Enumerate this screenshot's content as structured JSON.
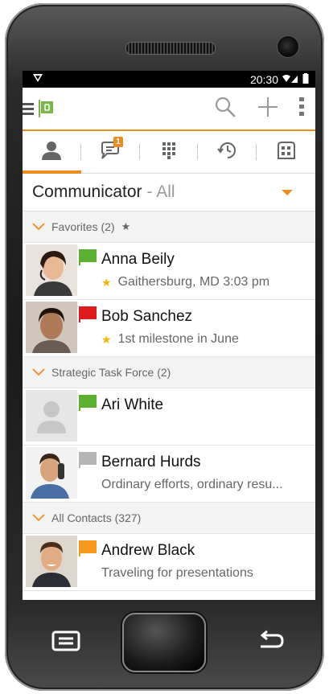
{
  "status": {
    "time": "20:30"
  },
  "app": {
    "filter_title": "Communicator",
    "filter_suffix": "- All"
  },
  "tabs": [
    {
      "name": "contacts",
      "active": true
    },
    {
      "name": "chats",
      "badge": "1"
    },
    {
      "name": "dialpad"
    },
    {
      "name": "history"
    },
    {
      "name": "directory"
    }
  ],
  "groups": {
    "favorites": "Favorites (2)",
    "strategic": "Strategic Task Force (2)",
    "all": "All Contacts (327)"
  },
  "contacts": [
    {
      "name": "Anna Beily",
      "sub": "Gaithersburg, MD  3:03 pm",
      "starred": true,
      "flag": "#5cb030"
    },
    {
      "name": "Bob Sanchez",
      "sub": "1st milestone in June",
      "starred": true,
      "flag": "#e11b1b"
    },
    {
      "name": "Ari White",
      "sub": "",
      "starred": false,
      "flag": "#5cb030"
    },
    {
      "name": "Bernard Hurds",
      "sub": "Ordinary efforts, ordinary resu...",
      "starred": false,
      "flag": "#b5b5b5"
    },
    {
      "name": "Andrew Black",
      "sub": "Traveling for presentations",
      "starred": false,
      "flag": "#f59a1e"
    }
  ],
  "colors": {
    "accent": "#f08c1e"
  }
}
